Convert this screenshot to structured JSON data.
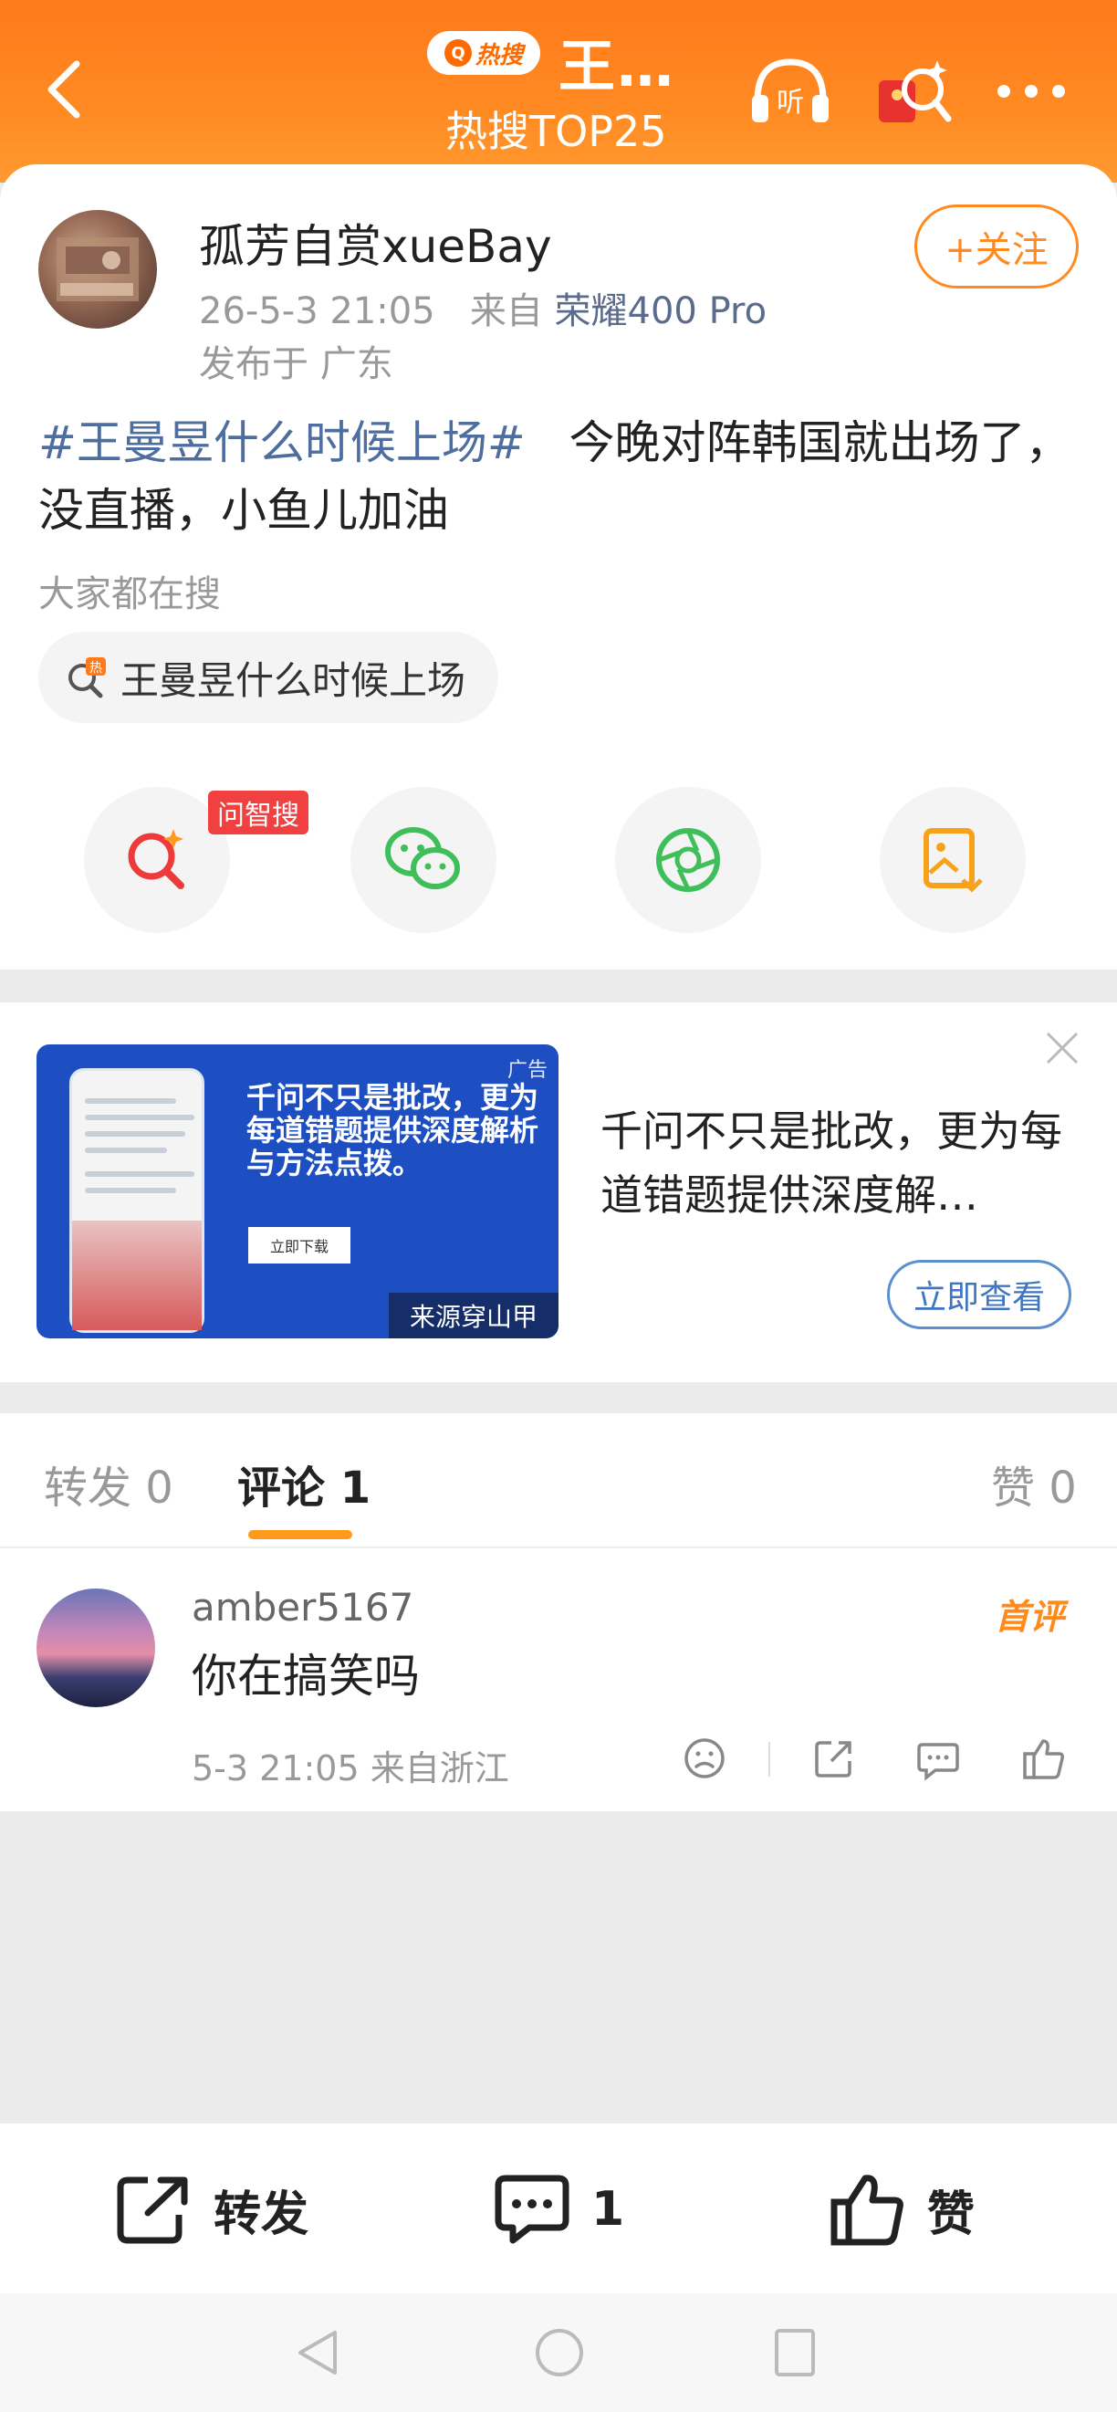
{
  "header": {
    "hot_badge_label": "热搜",
    "title": "王…",
    "subtitle": "热搜TOP25"
  },
  "post": {
    "username": "孤芳自赏xueBay",
    "time": "26-5-3 21:05",
    "from_label": "来自",
    "device": "荣耀400 Pro",
    "location": "发布于 广东",
    "follow_label": "+关注",
    "hashtag": "#王曼昱什么时候上场#",
    "text": "今晚对阵韩国就出场了，没直播，小鱼儿加油",
    "search_hint_title": "大家都在搜",
    "search_chip": "王曼昱什么时候上场",
    "ai_badge": "问智搜"
  },
  "ad": {
    "headline": "千问不只是批改，更为每道错题提供深度解析与方法点拨。",
    "tag": "广告",
    "download_label": "立即下载",
    "source": "来源穿山甲",
    "text": "千问不只是批改，更为每道错题提供深度解…",
    "view_label": "立即查看"
  },
  "tabs": {
    "repost": "转发 0",
    "comments": "评论 1",
    "likes": "赞 0"
  },
  "comment": {
    "username": "amber5167",
    "text": "你在搞笑吗",
    "meta": "5-3 21:05 来自浙江",
    "badge": "首评"
  },
  "bottom_bar": {
    "repost": "转发",
    "comment_count": "1",
    "like": "赞"
  },
  "colors": {
    "header_orange": "#ff7a1c",
    "accent_orange": "#ff8a20",
    "link_blue": "#4d6e9e",
    "ad_blue": "#1e4fc2"
  }
}
